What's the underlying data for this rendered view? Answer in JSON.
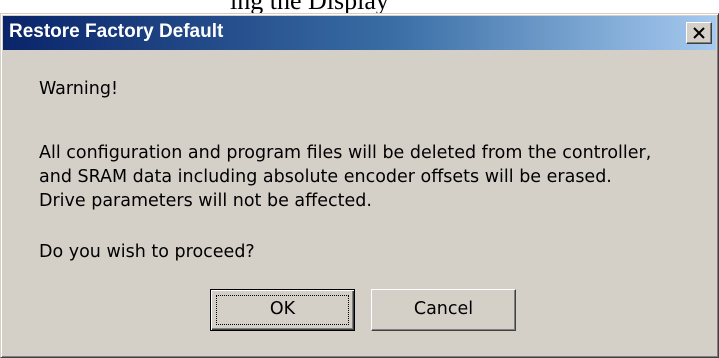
{
  "dialog": {
    "title": "Restore Factory Default",
    "close_icon": "close-icon",
    "warning": "Warning!",
    "message_lines": [
      "All configuration and program files will be deleted from the controller,",
      "and SRAM data including absolute encoder offsets will be erased.",
      "Drive parameters will not be affected."
    ],
    "question": "Do you wish to proceed?",
    "ok_label": "OK",
    "cancel_label": "Cancel"
  },
  "colors": {
    "title_bar_start": "#0a246a",
    "title_bar_end": "#a6caf0",
    "dialog_face": "#d4d0c8"
  }
}
